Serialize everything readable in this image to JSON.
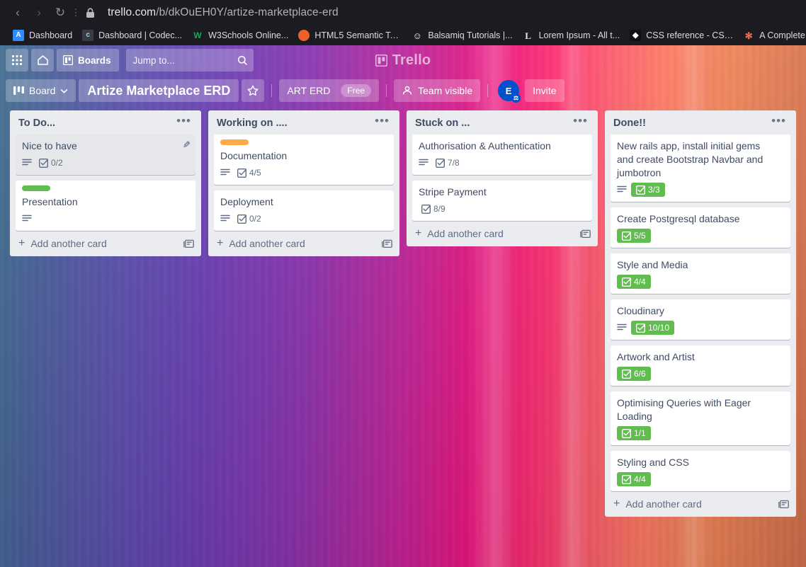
{
  "browser": {
    "back_label": "Back",
    "forward_label": "Forward",
    "reload_label": "Reload",
    "menu_label": "Page actions",
    "lock_label": "Site information",
    "url_domain": "trello.com",
    "url_path": "/b/dkOuEH0Y/artize-marketplace-erd",
    "bookmarks": [
      {
        "label": "Dashboard",
        "icon": "A",
        "icon_bg": "#2d8cff",
        "icon_fg": "#ffffff"
      },
      {
        "label": "Dashboard | Codec...",
        "icon": "c",
        "icon_bg": "#3a3a44",
        "icon_fg": "#9fd5e8"
      },
      {
        "label": "W3Schools Online...",
        "icon": "W",
        "icon_bg": "#1c1b22",
        "icon_fg": "#0fa958"
      },
      {
        "label": "HTML5 Semantic Ta...",
        "icon": "●",
        "icon_bg": "#e8622a",
        "icon_fg": "#ffffff"
      },
      {
        "label": "Balsamiq Tutorials |...",
        "icon": "☺",
        "icon_bg": "#1c1b22",
        "icon_fg": "#ffffff"
      },
      {
        "label": "Lorem Ipsum - All t...",
        "icon": "L",
        "icon_bg": "#1c1b22",
        "icon_fg": "#e8e8ec"
      },
      {
        "label": "CSS reference - CSS...",
        "icon": "⬟",
        "icon_bg": "#1c1b22",
        "icon_fg": "#ffffff"
      },
      {
        "label": "A Complete Guide",
        "icon": "✳",
        "icon_bg": "#1c1b22",
        "icon_fg": "#ff6b4a"
      }
    ]
  },
  "top_nav": {
    "apps_label": "Apps grid",
    "home_label": "Home",
    "boards_label": "Boards",
    "search_placeholder": "Jump to...",
    "search_value": "",
    "search_icon": "search-icon",
    "logo_text": "Trello"
  },
  "board_header": {
    "view_label": "Board",
    "board_title": "Artize Marketplace ERD",
    "star_label": "Star board",
    "team_name": "ART ERD",
    "plan_badge": "Free",
    "visibility_label": "Team visible",
    "avatar_initial": "E",
    "invite_label": "Invite"
  },
  "colors": {
    "label_green": "#61bd4f",
    "label_orange": "#ffab4a",
    "checklist_complete": "#61bd4f",
    "list_bg": "#ebecf0",
    "card_bg": "#ffffff",
    "text_primary": "#3f4c63",
    "text_muted": "#5e6c84",
    "avatar_bg": "#0052cc"
  },
  "lists": [
    {
      "title": "To Do...",
      "menu_label": "List actions",
      "add_card_label": "Add another card",
      "cards": [
        {
          "title": "Nice to have",
          "label_color": null,
          "has_description": true,
          "checklist": "0/2",
          "checklist_complete": false,
          "hovered": true,
          "show_edit": true
        },
        {
          "title": "Presentation",
          "label_color": "#61bd4f",
          "has_description": true,
          "checklist": null,
          "checklist_complete": false,
          "hovered": false,
          "show_edit": false
        }
      ]
    },
    {
      "title": "Working on ....",
      "menu_label": "List actions",
      "add_card_label": "Add another card",
      "cards": [
        {
          "title": "Documentation",
          "label_color": "#ffab4a",
          "has_description": true,
          "checklist": "4/5",
          "checklist_complete": false,
          "hovered": false,
          "show_edit": false
        },
        {
          "title": "Deployment",
          "label_color": null,
          "has_description": true,
          "checklist": "0/2",
          "checklist_complete": false,
          "hovered": false,
          "show_edit": false
        }
      ]
    },
    {
      "title": "Stuck on ...",
      "menu_label": "List actions",
      "add_card_label": "Add another card",
      "cards": [
        {
          "title": "Authorisation & Authentication",
          "label_color": null,
          "has_description": true,
          "checklist": "7/8",
          "checklist_complete": false,
          "hovered": false,
          "show_edit": false
        },
        {
          "title": "Stripe Payment",
          "label_color": null,
          "has_description": false,
          "checklist": "8/9",
          "checklist_complete": false,
          "hovered": false,
          "show_edit": false
        }
      ]
    },
    {
      "title": "Done!!",
      "menu_label": "List actions",
      "add_card_label": "Add another card",
      "cards": [
        {
          "title": "New rails app, install initial gems and create Bootstrap Navbar and jumbotron",
          "label_color": null,
          "has_description": true,
          "checklist": "3/3",
          "checklist_complete": true,
          "hovered": false,
          "show_edit": false
        },
        {
          "title": "Create Postgresql database",
          "label_color": null,
          "has_description": false,
          "checklist": "5/5",
          "checklist_complete": true,
          "hovered": false,
          "show_edit": false
        },
        {
          "title": "Style and Media",
          "label_color": null,
          "has_description": false,
          "checklist": "4/4",
          "checklist_complete": true,
          "hovered": false,
          "show_edit": false
        },
        {
          "title": "Cloudinary",
          "label_color": null,
          "has_description": true,
          "checklist": "10/10",
          "checklist_complete": true,
          "hovered": false,
          "show_edit": false
        },
        {
          "title": "Artwork and Artist",
          "label_color": null,
          "has_description": false,
          "checklist": "6/6",
          "checklist_complete": true,
          "hovered": false,
          "show_edit": false
        },
        {
          "title": "Optimising Queries with Eager Loading",
          "label_color": null,
          "has_description": false,
          "checklist": "1/1",
          "checklist_complete": true,
          "hovered": false,
          "show_edit": false
        },
        {
          "title": "Styling and CSS",
          "label_color": null,
          "has_description": false,
          "checklist": "4/4",
          "checklist_complete": true,
          "hovered": false,
          "show_edit": false
        }
      ]
    }
  ]
}
